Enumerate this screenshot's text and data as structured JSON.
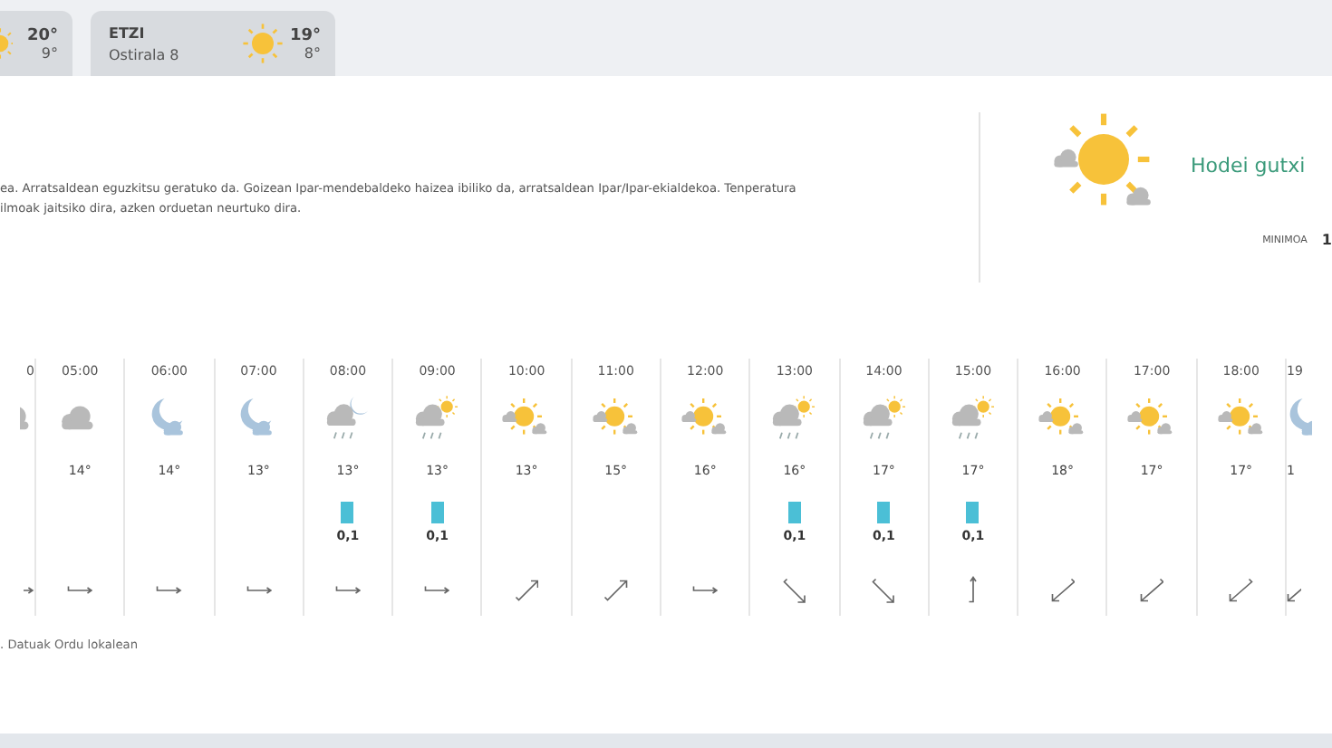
{
  "day_tabs": [
    {
      "kind": "partial",
      "high": "20°",
      "low": "9°"
    },
    {
      "kind": "full",
      "label": "ETZI",
      "date": "Ostirala 8",
      "high": "19°",
      "low": "8°"
    }
  ],
  "forecast": {
    "lines": [
      "ea. Arratsaldean eguzkitsu geratuko da. Goizean Ipar-mendebaldeko haizea ibiliko da, arratsaldean Ipar/Ipar-ekialdekoa. Tenperatura",
      "ilmoak jaitsiko dira, azken orduetan neurtuko dira."
    ],
    "sky": {
      "kind": "sun-cloud"
    },
    "condition": "Hodei gutxi",
    "min_label": "MINIMOA",
    "min_value": "1"
  },
  "hours": [
    {
      "kind": "cut-left",
      "time": "0",
      "sky": {
        "kind": "cloudy"
      },
      "wind": {
        "kind": "east"
      }
    },
    {
      "kind": "full",
      "time": "05:00",
      "sky": {
        "kind": "cloudy"
      },
      "temp": "14°",
      "wind": {
        "kind": "east"
      }
    },
    {
      "kind": "full",
      "time": "06:00",
      "sky": {
        "kind": "moon-cloud"
      },
      "temp": "14°",
      "wind": {
        "kind": "east"
      }
    },
    {
      "kind": "full",
      "time": "07:00",
      "sky": {
        "kind": "moon-cloud"
      },
      "temp": "13°",
      "wind": {
        "kind": "east"
      }
    },
    {
      "kind": "full",
      "time": "08:00",
      "sky": {
        "kind": "moon-rain"
      },
      "temp": "13°",
      "rain": "0,1",
      "wind": {
        "kind": "east"
      }
    },
    {
      "kind": "full",
      "time": "09:00",
      "sky": {
        "kind": "sun-rain"
      },
      "temp": "13°",
      "rain": "0,1",
      "wind": {
        "kind": "east"
      }
    },
    {
      "kind": "full",
      "time": "10:00",
      "sky": {
        "kind": "sun-cloud"
      },
      "temp": "13°",
      "wind": {
        "kind": "northeast"
      }
    },
    {
      "kind": "full",
      "time": "11:00",
      "sky": {
        "kind": "sun-cloud"
      },
      "temp": "15°",
      "wind": {
        "kind": "northeast"
      }
    },
    {
      "kind": "full",
      "time": "12:00",
      "sky": {
        "kind": "sun-cloud"
      },
      "temp": "16°",
      "wind": {
        "kind": "east"
      }
    },
    {
      "kind": "full",
      "time": "13:00",
      "sky": {
        "kind": "sun-rain"
      },
      "temp": "16°",
      "rain": "0,1",
      "wind": {
        "kind": "southeast"
      }
    },
    {
      "kind": "full",
      "time": "14:00",
      "sky": {
        "kind": "sun-rain"
      },
      "temp": "17°",
      "rain": "0,1",
      "wind": {
        "kind": "southeast"
      }
    },
    {
      "kind": "full",
      "time": "15:00",
      "sky": {
        "kind": "sun-rain"
      },
      "temp": "17°",
      "rain": "0,1",
      "wind": {
        "kind": "north"
      }
    },
    {
      "kind": "full",
      "time": "16:00",
      "sky": {
        "kind": "sun-cloud"
      },
      "temp": "18°",
      "wind": {
        "kind": "southwest"
      }
    },
    {
      "kind": "full",
      "time": "17:00",
      "sky": {
        "kind": "sun-cloud"
      },
      "temp": "17°",
      "wind": {
        "kind": "southwest"
      }
    },
    {
      "kind": "full",
      "time": "18:00",
      "sky": {
        "kind": "sun-cloud"
      },
      "temp": "17°",
      "wind": {
        "kind": "southwest"
      }
    },
    {
      "kind": "cut-right",
      "time": "19",
      "sky": {
        "kind": "moon-cloud"
      },
      "temp": "1",
      "wind": {
        "kind": "southwest"
      }
    }
  ],
  "footnote": ". Datuak Ordu lokalean"
}
